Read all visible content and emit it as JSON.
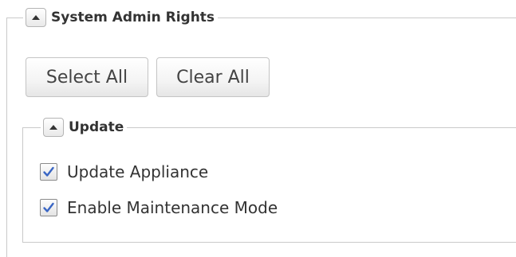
{
  "section": {
    "title": "System Admin Rights",
    "collapse_icon": "triangle-up-icon",
    "select_all_label": "Select All",
    "clear_all_label": "Clear All"
  },
  "subsection": {
    "title": "Update",
    "collapse_icon": "triangle-up-icon",
    "items": [
      {
        "label": "Update Appliance",
        "checked": true
      },
      {
        "label": "Enable Maintenance Mode",
        "checked": true
      }
    ]
  },
  "colors": {
    "border": "#c9c9c9",
    "text": "#333333",
    "check": "#3a66c4"
  }
}
